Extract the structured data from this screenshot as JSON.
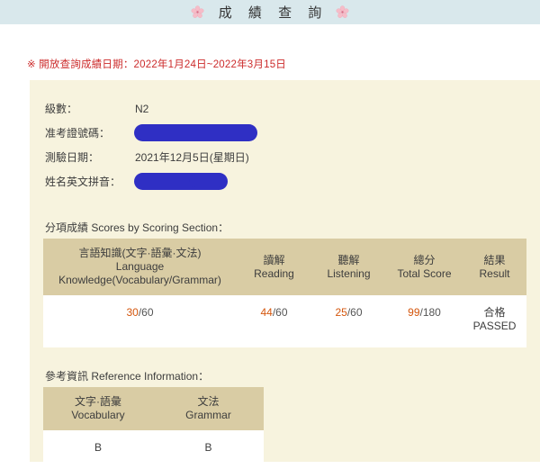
{
  "header": {
    "title": "成 績 查 詢",
    "left_icon": "cherry-blossom-icon",
    "right_icon": "cherry-blossom-icon",
    "band_color": "#d9e8ec"
  },
  "notice": {
    "text": "※ 開放查詢成績日期：2022年1月24日~2022年3月15日",
    "color": "#cc2b2b"
  },
  "candidate_info": [
    {
      "label": "級數：",
      "value": "N2",
      "redacted": false
    },
    {
      "label": "准考證號碼：",
      "value": "",
      "redacted": true
    },
    {
      "label": "測驗日期：",
      "value": "2021年12月5日(星期日)",
      "redacted": false
    },
    {
      "label": "姓名英文拼音：",
      "value": "",
      "redacted": true
    }
  ],
  "scores_section": {
    "caption": "分項成績 Scores by Scoring Section：",
    "columns": [
      {
        "zh": "言語知識(文字·語彙·文法)",
        "en_line1": "Language",
        "en_line2": "Knowledge(Vocabulary/Grammar)"
      },
      {
        "zh": "讀解",
        "en_line1": "Reading",
        "en_line2": ""
      },
      {
        "zh": "聽解",
        "en_line1": "Listening",
        "en_line2": ""
      },
      {
        "zh": "總分",
        "en_line1": "Total Score",
        "en_line2": ""
      },
      {
        "zh": "結果",
        "en_line1": "Result",
        "en_line2": ""
      }
    ],
    "values": {
      "language_knowledge_score": "30",
      "language_knowledge_max": "/60",
      "reading_score": "44",
      "reading_max": "/60",
      "listening_score": "25",
      "listening_max": "/60",
      "total_score": "99",
      "total_max": "/180",
      "result_zh": "合格",
      "result_en": "PASSED"
    }
  },
  "reference_section": {
    "caption": "參考資訊 Reference Information：",
    "columns": [
      {
        "zh": "文字·語彙",
        "en": "Vocabulary"
      },
      {
        "zh": "文法",
        "en": "Grammar"
      }
    ],
    "values": {
      "vocabulary_grade": "B",
      "grammar_grade": "B"
    }
  },
  "colors": {
    "score_accent": "#d4560d",
    "panel_background": "#f7f3de",
    "table_header": "#d9cca4",
    "notice_red": "#cc2b2b",
    "redaction": "#2f2fc4"
  }
}
